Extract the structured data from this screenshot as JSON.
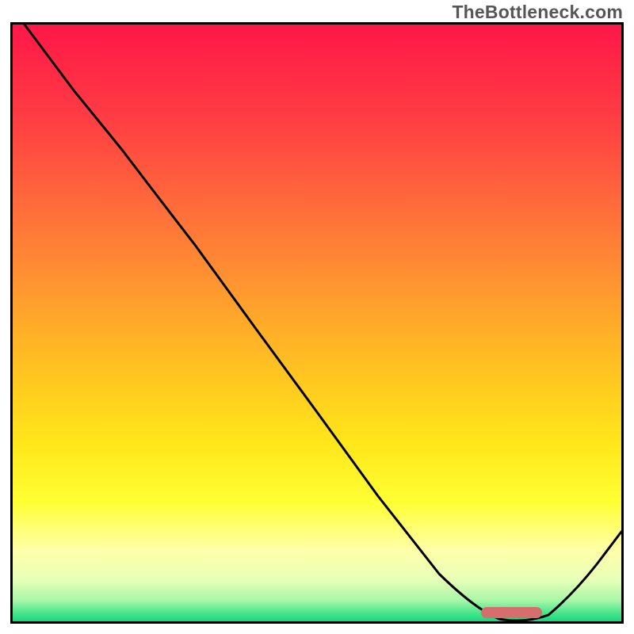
{
  "watermark": "TheBottleneck.com",
  "chart_data": {
    "type": "line",
    "title": "",
    "xlabel": "",
    "ylabel": "",
    "xlim": [
      0,
      100
    ],
    "ylim": [
      0,
      100
    ],
    "series": [
      {
        "name": "curve",
        "x": [
          2,
          10,
          18,
          25,
          30,
          40,
          50,
          60,
          70,
          76,
          80,
          84,
          88,
          92,
          96,
          100
        ],
        "y": [
          100,
          89,
          79,
          69.5,
          63,
          49,
          35,
          21,
          8,
          2,
          0,
          0,
          1,
          4.5,
          9.5,
          15
        ]
      }
    ],
    "marker": {
      "name": "optimum-bar",
      "x_start": 77,
      "x_end": 87,
      "y": 1.2,
      "color": "#d66e6e"
    },
    "background_gradient_stops": [
      {
        "offset": 0.0,
        "color": "#ff1748"
      },
      {
        "offset": 0.15,
        "color": "#ff3b44"
      },
      {
        "offset": 0.3,
        "color": "#ff6a3b"
      },
      {
        "offset": 0.45,
        "color": "#ff9a2f"
      },
      {
        "offset": 0.58,
        "color": "#ffc321"
      },
      {
        "offset": 0.7,
        "color": "#ffe61a"
      },
      {
        "offset": 0.8,
        "color": "#ffff33"
      },
      {
        "offset": 0.88,
        "color": "#ffffa8"
      },
      {
        "offset": 0.93,
        "color": "#e8ffb8"
      },
      {
        "offset": 0.965,
        "color": "#a8f7a8"
      },
      {
        "offset": 0.985,
        "color": "#4de68e"
      },
      {
        "offset": 1.0,
        "color": "#14d87c"
      }
    ]
  }
}
